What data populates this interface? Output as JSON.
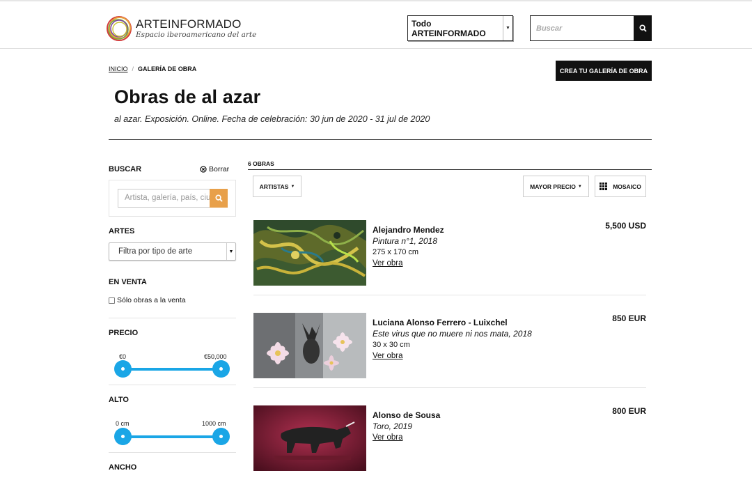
{
  "header": {
    "logo_name": "ARTEINFORMADO",
    "logo_tagline": "Espacio iberoamericano del arte",
    "scope_select_value": "Todo ARTEINFORMADO",
    "search_placeholder": "Buscar",
    "icons": {
      "search": "magnifier-icon",
      "caret": "caret-down-icon"
    }
  },
  "breadcrumb": {
    "home": "INICIO",
    "separator": "/",
    "current": "GALERÍA DE OBRA"
  },
  "create_button": "CREA TU GALERÍA DE OBRA",
  "page": {
    "title": "Obras de al azar",
    "subtitle": "al azar. Exposición. Online. Fecha de celebración: 30 jun de 2020 - 31 jul de 2020"
  },
  "sidebar": {
    "search_heading": "BUSCAR",
    "clear_label": "Borrar",
    "search_placeholder": "Artista, galería, país, ciudad...",
    "arts_heading": "ARTES",
    "arts_select_value": "Filtra por tipo de arte",
    "sale_heading": "EN VENTA",
    "sale_checkbox_label": "Sólo obras a la venta",
    "sale_checkbox_checked": false,
    "price": {
      "heading": "PRECIO",
      "min_label": "€0",
      "max_label": "€50,000",
      "min_value": 0,
      "max_value": 50000
    },
    "height": {
      "heading": "ALTO",
      "min_label": "0 cm",
      "max_label": "1000 cm",
      "min_value": 0,
      "max_value": 1000
    },
    "width_heading": "ANCHO",
    "accent_color": "#1aa6e6",
    "search_button_color": "#e8a04a"
  },
  "results": {
    "count_label": "6 OBRAS",
    "artists_filter": "ARTISTAS",
    "sort_filter": "MAYOR PRECIO",
    "view_mode": "MOSAICO",
    "items": [
      {
        "artist": "Alejandro Mendez",
        "title": "Pintura n°1, 2018",
        "size": "275 x 170 cm",
        "link": "Ver obra",
        "price": "5,500 USD"
      },
      {
        "artist": "Luciana Alonso Ferrero - Luixchel",
        "title": "Este virus que no muere ni nos mata, 2018",
        "size": "30 x 30 cm",
        "link": "Ver obra",
        "price": "850 EUR"
      },
      {
        "artist": "Alonso de Sousa",
        "title": "Toro, 2019",
        "size": "",
        "link": "Ver obra",
        "price": "800 EUR"
      }
    ]
  }
}
